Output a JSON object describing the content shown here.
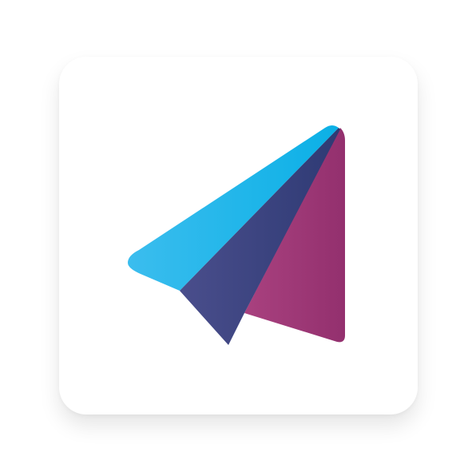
{
  "icon": {
    "name": "paper-plane-logo",
    "colors": {
      "cyan_wing_light": "#3BBDEE",
      "cyan_wing_dark": "#0BB0E6",
      "navy_fold_light": "#4A4E8C",
      "navy_fold_dark": "#2E3A74",
      "magenta_wing_light": "#A9417F",
      "magenta_wing_dark": "#93306E",
      "tile_background": "#FFFFFF",
      "page_background": "#FFFFFF"
    }
  }
}
